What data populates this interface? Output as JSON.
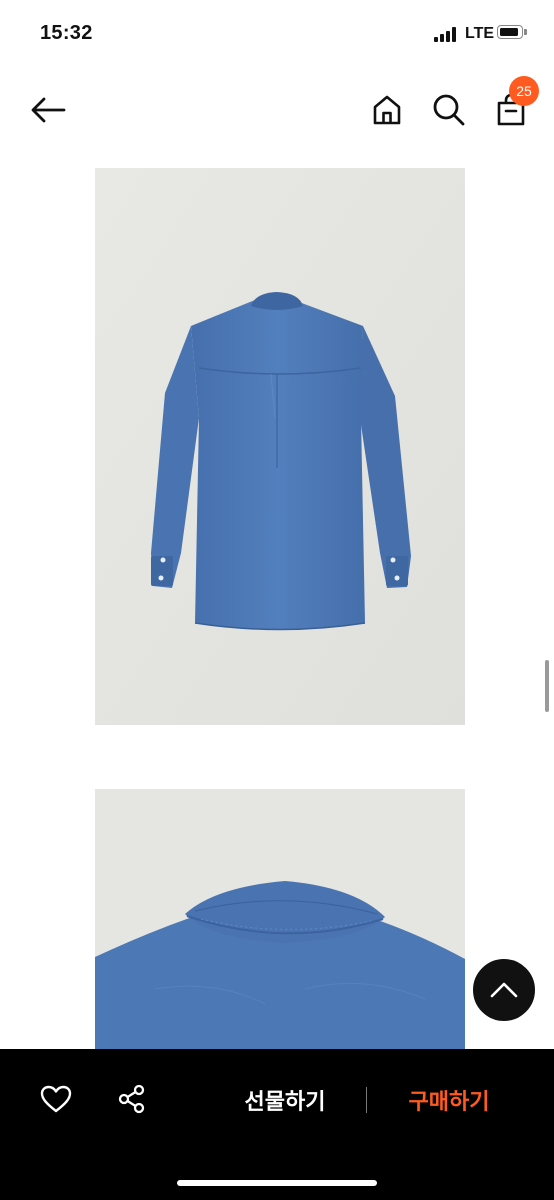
{
  "status_bar": {
    "time": "15:32",
    "network": "LTE"
  },
  "nav": {
    "cart_count": "25",
    "icons": [
      "back-arrow-icon",
      "home-icon",
      "search-icon",
      "shopping-bag-icon"
    ]
  },
  "bottom_bar": {
    "gift_label": "선물하기",
    "buy_label": "구매하기",
    "icons": [
      "heart-icon",
      "share-icon"
    ]
  },
  "colors": {
    "accent": "#ff5a1f",
    "bottom_bar_bg": "#000000",
    "shirt_blue": "#4d79b8"
  }
}
